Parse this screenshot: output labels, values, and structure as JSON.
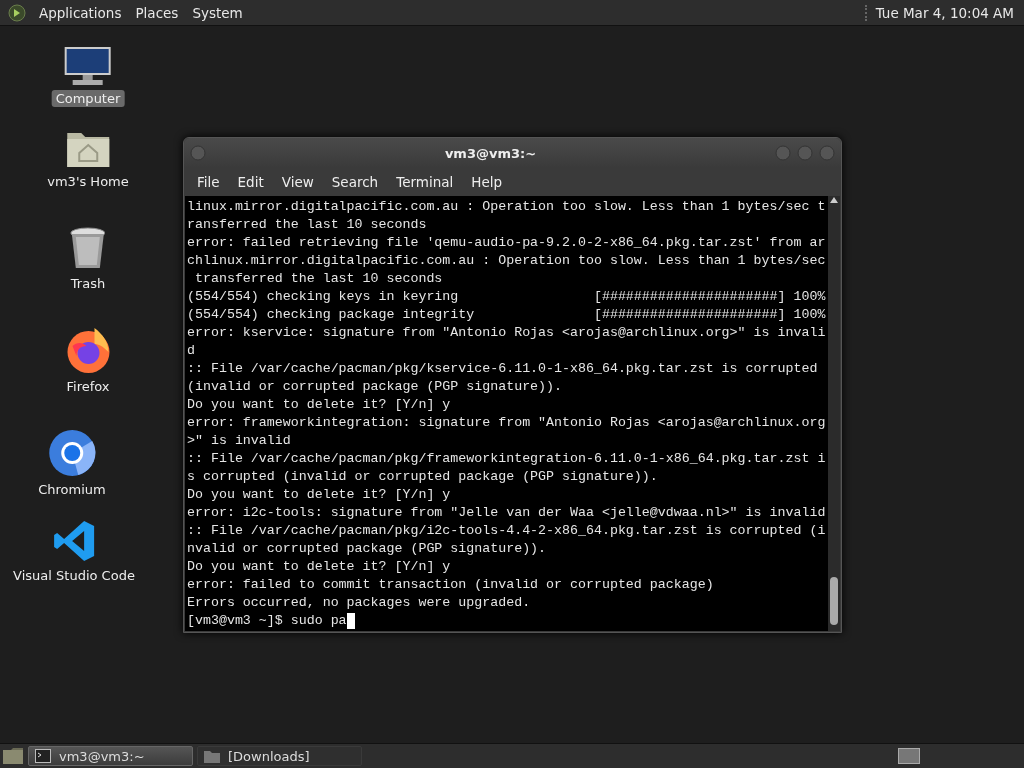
{
  "top_panel": {
    "menus": [
      "Applications",
      "Places",
      "System"
    ],
    "clock": "Tue Mar  4, 10:04 AM"
  },
  "desktop_icons": [
    {
      "label": "Computer",
      "kind": "computer",
      "selected": true
    },
    {
      "label": "vm3's Home",
      "kind": "home",
      "selected": false
    },
    {
      "label": "Trash",
      "kind": "trash",
      "selected": false
    },
    {
      "label": "Firefox",
      "kind": "firefox",
      "selected": false
    },
    {
      "label": "Chromium",
      "kind": "chromium",
      "selected": false
    },
    {
      "label": "Visual Studio Code",
      "kind": "vscode",
      "selected": false
    }
  ],
  "terminal_window": {
    "title": "vm3@vm3:~",
    "menus": [
      "File",
      "Edit",
      "View",
      "Search",
      "Terminal",
      "Help"
    ],
    "lines": [
      "linux.mirror.digitalpacific.com.au : Operation too slow. Less than 1 bytes/sec t",
      "ransferred the last 10 seconds",
      "error: failed retrieving file 'qemu-audio-pa-9.2.0-2-x86_64.pkg.tar.zst' from ar",
      "chlinux.mirror.digitalpacific.com.au : Operation too slow. Less than 1 bytes/sec",
      " transferred the last 10 seconds",
      "(554/554) checking keys in keyring                 [######################] 100%",
      "(554/554) checking package integrity               [######################] 100%",
      "error: kservice: signature from \"Antonio Rojas <arojas@archlinux.org>\" is invali",
      "d",
      ":: File /var/cache/pacman/pkg/kservice-6.11.0-1-x86_64.pkg.tar.zst is corrupted",
      "(invalid or corrupted package (PGP signature)).",
      "Do you want to delete it? [Y/n] y",
      "error: frameworkintegration: signature from \"Antonio Rojas <arojas@archlinux.org",
      ">\" is invalid",
      ":: File /var/cache/pacman/pkg/frameworkintegration-6.11.0-1-x86_64.pkg.tar.zst i",
      "s corrupted (invalid or corrupted package (PGP signature)).",
      "Do you want to delete it? [Y/n] y",
      "error: i2c-tools: signature from \"Jelle van der Waa <jelle@vdwaa.nl>\" is invalid",
      ":: File /var/cache/pacman/pkg/i2c-tools-4.4-2-x86_64.pkg.tar.zst is corrupted (i",
      "nvalid or corrupted package (PGP signature)).",
      "Do you want to delete it? [Y/n] y",
      "error: failed to commit transaction (invalid or corrupted package)",
      "Errors occurred, no packages were upgraded."
    ],
    "prompt": "[vm3@vm3 ~]$ sudo pa"
  },
  "taskbar": {
    "tasks": [
      {
        "label": "vm3@vm3:~",
        "kind": "terminal",
        "selected": true
      },
      {
        "label": "[Downloads]",
        "kind": "folder",
        "selected": false
      }
    ]
  }
}
